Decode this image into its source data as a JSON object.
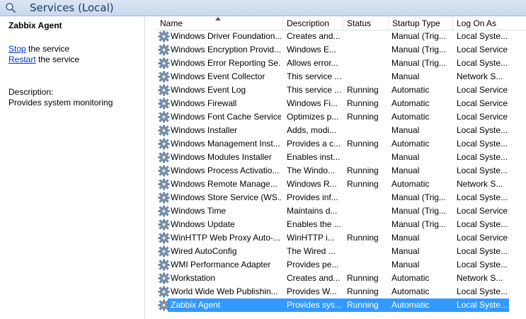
{
  "window": {
    "title": "Services (Local)",
    "icon": "search-services-icon"
  },
  "details": {
    "service_name": "Zabbix Agent",
    "actions": [
      {
        "link": "Stop",
        "rest": " the service"
      },
      {
        "link": "Restart",
        "rest": " the service"
      }
    ],
    "description_label": "Description:",
    "description_text": "Provides system monitoring"
  },
  "columns": {
    "name": "Name",
    "description": "Description",
    "status": "Status",
    "startup_type": "Startup Type",
    "log_on_as": "Log On As",
    "sorted_by": "Name",
    "sort_direction": "ascending"
  },
  "colors": {
    "selection": "#3399ff",
    "link": "#0033cc"
  },
  "services": [
    {
      "name": "Windows Driver Foundation...",
      "description": "Creates and...",
      "status": "",
      "startup": "Manual (Trig...",
      "logon": "Local Syste..."
    },
    {
      "name": "Windows Encryption Provid...",
      "description": "Windows E...",
      "status": "",
      "startup": "Manual (Trig...",
      "logon": "Local Service"
    },
    {
      "name": "Windows Error Reporting Se...",
      "description": "Allows error...",
      "status": "",
      "startup": "Manual (Trig...",
      "logon": "Local Syste..."
    },
    {
      "name": "Windows Event Collector",
      "description": "This service ...",
      "status": "",
      "startup": "Manual",
      "logon": "Network S..."
    },
    {
      "name": "Windows Event Log",
      "description": "This service ...",
      "status": "Running",
      "startup": "Automatic",
      "logon": "Local Service"
    },
    {
      "name": "Windows Firewall",
      "description": "Windows Fi...",
      "status": "Running",
      "startup": "Automatic",
      "logon": "Local Service"
    },
    {
      "name": "Windows Font Cache Service",
      "description": "Optimizes p...",
      "status": "Running",
      "startup": "Automatic",
      "logon": "Local Service"
    },
    {
      "name": "Windows Installer",
      "description": "Adds, modi...",
      "status": "",
      "startup": "Manual",
      "logon": "Local Syste..."
    },
    {
      "name": "Windows Management Inst...",
      "description": "Provides a c...",
      "status": "Running",
      "startup": "Automatic",
      "logon": "Local Syste..."
    },
    {
      "name": "Windows Modules Installer",
      "description": "Enables inst...",
      "status": "",
      "startup": "Manual",
      "logon": "Local Syste..."
    },
    {
      "name": "Windows Process Activatio...",
      "description": "The Windo...",
      "status": "Running",
      "startup": "Manual",
      "logon": "Local Syste..."
    },
    {
      "name": "Windows Remote Manage...",
      "description": "Windows R...",
      "status": "Running",
      "startup": "Automatic",
      "logon": "Network S..."
    },
    {
      "name": "Windows Store Service (WS...",
      "description": "Provides inf...",
      "status": "",
      "startup": "Manual (Trig...",
      "logon": "Local Syste..."
    },
    {
      "name": "Windows Time",
      "description": "Maintains d...",
      "status": "",
      "startup": "Manual (Trig...",
      "logon": "Local Service"
    },
    {
      "name": "Windows Update",
      "description": "Enables the ...",
      "status": "",
      "startup": "Manual (Trig...",
      "logon": "Local Syste..."
    },
    {
      "name": "WinHTTP Web Proxy Auto-...",
      "description": "WinHTTP i...",
      "status": "Running",
      "startup": "Manual",
      "logon": "Local Service"
    },
    {
      "name": "Wired AutoConfig",
      "description": "The Wired ...",
      "status": "",
      "startup": "Manual",
      "logon": "Local Syste..."
    },
    {
      "name": "WMI Performance Adapter",
      "description": "Provides pe...",
      "status": "",
      "startup": "Manual",
      "logon": "Local Syste..."
    },
    {
      "name": "Workstation",
      "description": "Creates and...",
      "status": "Running",
      "startup": "Automatic",
      "logon": "Network S..."
    },
    {
      "name": "World Wide Web Publishin...",
      "description": "Provides W...",
      "status": "Running",
      "startup": "Automatic",
      "logon": "Local Syste..."
    },
    {
      "name": "Zabbix Agent",
      "description": "Provides sys...",
      "status": "Running",
      "startup": "Automatic",
      "logon": "Local Syste...",
      "selected": true
    }
  ]
}
